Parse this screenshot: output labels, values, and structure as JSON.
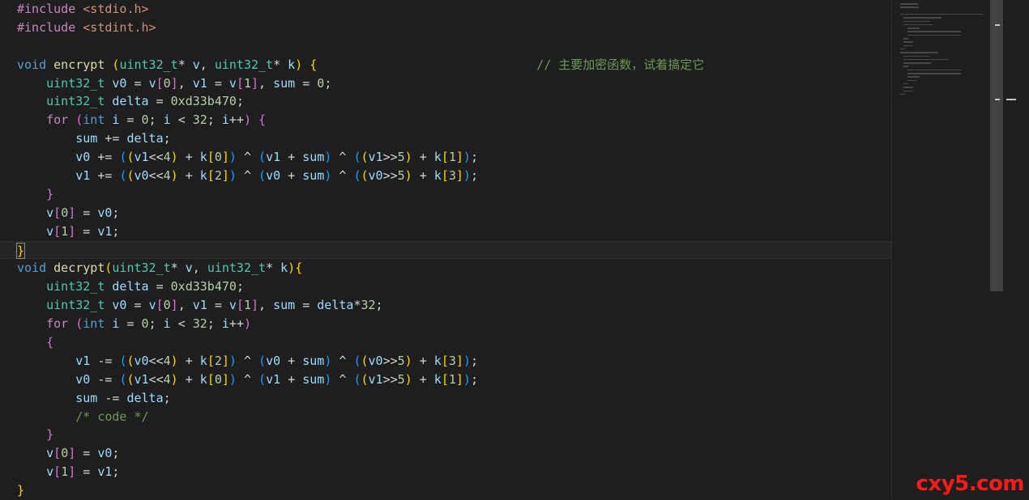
{
  "editor": {
    "language": "c",
    "lines": [
      "#include <stdio.h>",
      "#include <stdint.h>",
      "",
      "void encrypt (uint32_t* v, uint32_t* k) {                              // 主要加密函数，试着搞定它",
      "    uint32_t v0 = v[0], v1 = v[1], sum = 0;",
      "    uint32_t delta = 0xd33b470;",
      "    for (int i = 0; i < 32; i++) {",
      "        sum += delta;",
      "        v0 += ((v1<<4) + k[0]) ^ (v1 + sum) ^ ((v1>>5) + k[1]);",
      "        v1 += ((v0<<4) + k[2]) ^ (v0 + sum) ^ ((v0>>5) + k[3]);",
      "    }",
      "    v[0] = v0;",
      "    v[1] = v1;",
      "}",
      "void decrypt(uint32_t* v, uint32_t* k){",
      "    uint32_t delta = 0xd33b470;",
      "    uint32_t v0 = v[0], v1 = v[1], sum = delta*32;",
      "    for (int i = 0; i < 32; i++)",
      "    {",
      "        v1 -= ((v0<<4) + k[2]) ^ (v0 + sum) ^ ((v0>>5) + k[3]);",
      "        v0 -= ((v1<<4) + k[0]) ^ (v1 + sum) ^ ((v1>>5) + k[1]);",
      "        sum -= delta;",
      "        /* code */",
      "    }",
      "    v[0] = v0;",
      "    v[1] = v1;",
      "}"
    ],
    "current_line_index": 13
  },
  "watermark": {
    "text": "cxy5.com"
  },
  "colors": {
    "background": "#1e1e1e",
    "preprocessor": "#c586c0",
    "string": "#ce9178",
    "keyword": "#569cd6",
    "type": "#4ec9b0",
    "function": "#dcdcaa",
    "variable": "#9cdcfe",
    "number": "#b5cea8",
    "comment": "#6a9955",
    "bracket_level_1": "#ffd700",
    "bracket_level_2": "#da70d6",
    "bracket_level_3": "#179fff",
    "watermark": "#ff1a1a"
  }
}
